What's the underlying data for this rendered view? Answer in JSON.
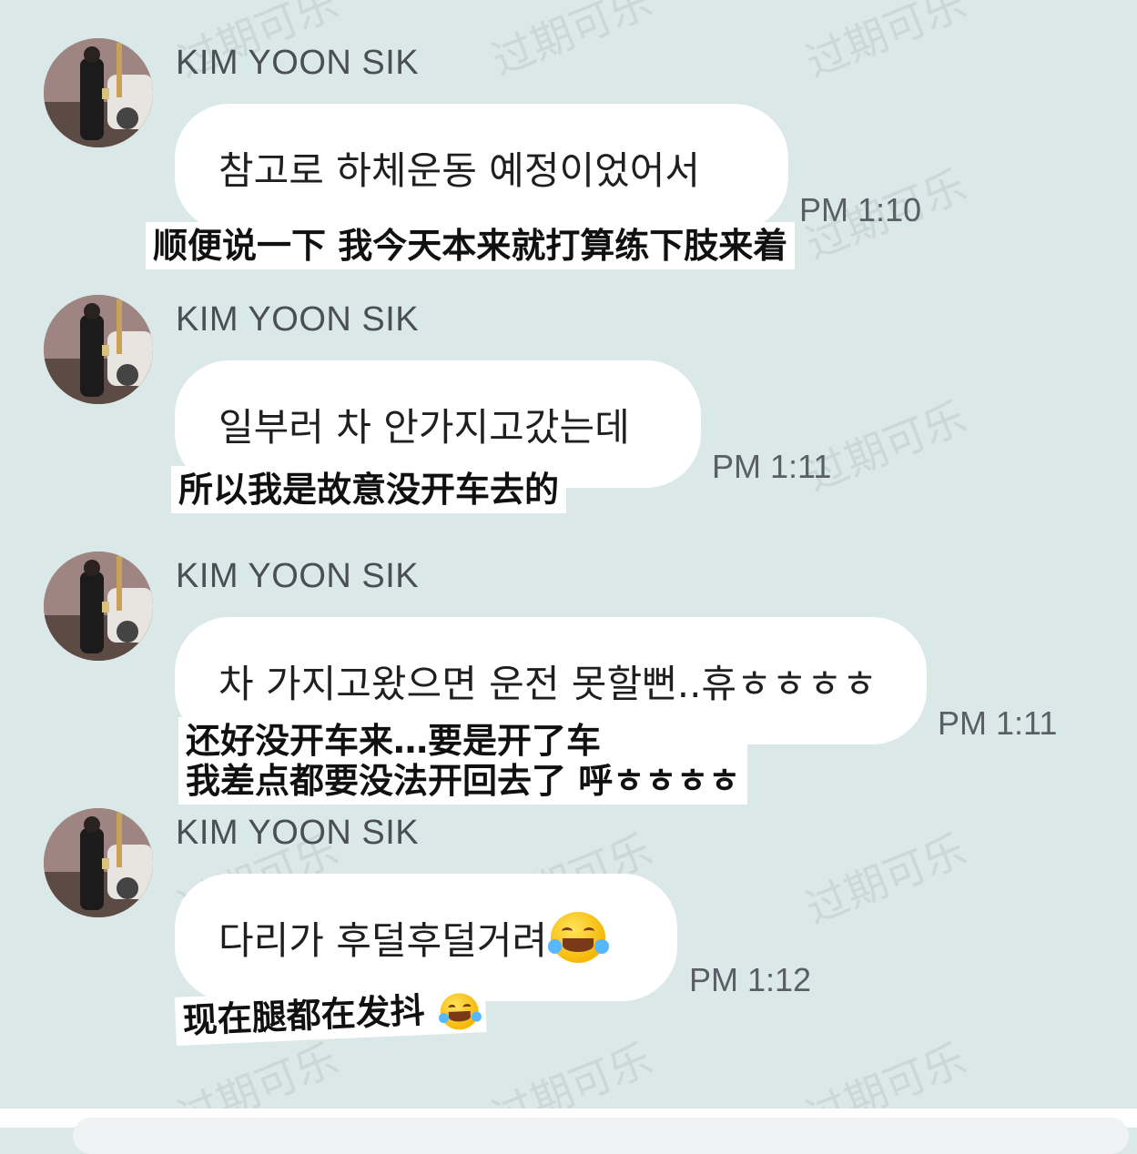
{
  "watermark": "过期可乐",
  "messages": [
    {
      "sender": "KIM YOON SIK",
      "text": "참고로 하체운동 예정이었어서",
      "time": "PM 1:10",
      "caption": [
        "顺便说一下 我今天本来就打算练下肢来着"
      ]
    },
    {
      "sender": "KIM YOON SIK",
      "text": "일부러 차 안가지고갔는데",
      "time": "PM 1:11",
      "caption": [
        "所以我是故意没开车去的"
      ]
    },
    {
      "sender": "KIM YOON SIK",
      "text": "차 가지고왔으면 운전 못할뻔..휴ㅎㅎㅎㅎ",
      "time": "PM 1:11",
      "caption": [
        "还好没开车来…要是开了车",
        "我差点都要没法开回去了 呼ㅎㅎㅎㅎ"
      ]
    },
    {
      "sender": "KIM YOON SIK",
      "text": "다리가 후덜후덜거려",
      "time": "PM 1:12",
      "caption": [
        "现在腿都在发抖"
      ]
    }
  ],
  "icons": {
    "emoji": "face-with-tears-of-joy-icon",
    "avatar": "profile-photo"
  },
  "colors": {
    "background": "#dbe8e8",
    "bubble": "#ffffff",
    "sender_text": "#4a4f55",
    "time_text": "#5a5f66"
  }
}
